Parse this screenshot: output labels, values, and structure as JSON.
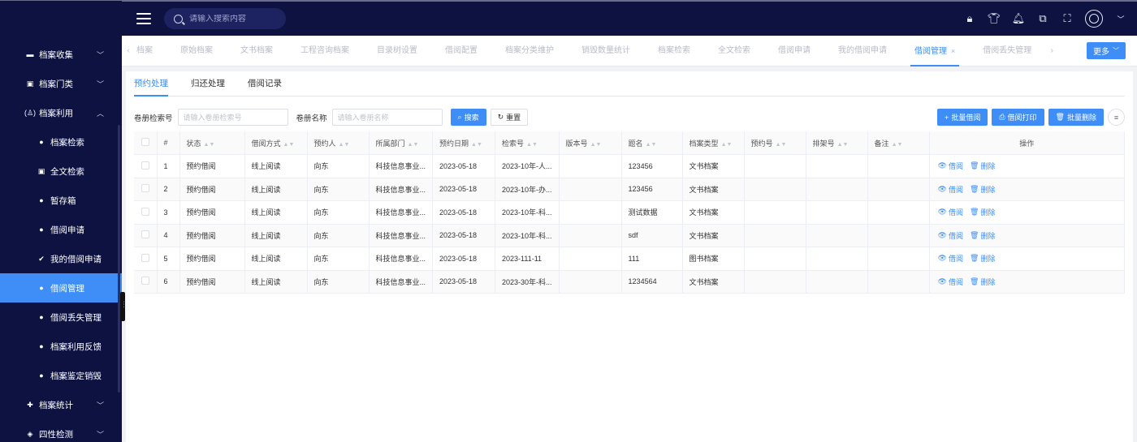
{
  "search": {
    "placeholder": "请输入搜索内容"
  },
  "sidebar": {
    "items": [
      {
        "label": "档案收集",
        "icon": "folder-icon",
        "chev": "﹀"
      },
      {
        "label": "档案门类",
        "icon": "calendar-icon",
        "chev": "﹀"
      },
      {
        "label": "档案利用",
        "icon": "person-icon",
        "chev": "︿"
      },
      {
        "label": "档案检索",
        "icon": "dot-icon"
      },
      {
        "label": "全文检索",
        "icon": "doc-icon"
      },
      {
        "label": "暂存箱",
        "icon": "dot-icon"
      },
      {
        "label": "借阅申请",
        "icon": "dot-icon"
      },
      {
        "label": "我的借阅申请",
        "icon": "check-icon"
      },
      {
        "label": "借阅管理",
        "icon": "dot-icon"
      },
      {
        "label": "借阅丢失管理",
        "icon": "dot-icon"
      },
      {
        "label": "档案利用反馈",
        "icon": "dot-icon"
      },
      {
        "label": "档案鉴定销毁",
        "icon": "dot-icon"
      },
      {
        "label": "档案统计",
        "icon": "plus-icon",
        "chev": "﹀"
      },
      {
        "label": "四性检测",
        "icon": "shield-icon",
        "chev": "﹀"
      }
    ]
  },
  "tabs": {
    "items": [
      "档案",
      "原始档案",
      "文书档案",
      "工程咨询档案",
      "目录树设置",
      "借阅配置",
      "档案分类维护",
      "销毁数量统计",
      "档案检索",
      "全文检索",
      "借阅申请",
      "我的借阅申请",
      "借阅管理",
      "借阅丢失管理"
    ],
    "close": "×",
    "more": "更多"
  },
  "subtabs": [
    "预约处理",
    "归还处理",
    "借阅记录"
  ],
  "filters": {
    "label1": "卷册检索号",
    "placeholder1": "请输入卷册检索号",
    "label2": "卷册名称",
    "placeholder2": "请输入卷册名称",
    "search_btn": "搜索",
    "reset_btn": "重置"
  },
  "actions": {
    "batch_borrow": "批量借阅",
    "borrow_print": "借阅打印",
    "batch_delete": "批量删除"
  },
  "table": {
    "headers": [
      "#",
      "状态",
      "借阅方式",
      "预约人",
      "所属部门",
      "预约日期",
      "检索号",
      "版本号",
      "题名",
      "档案类型",
      "预约号",
      "排架号",
      "备注",
      "操作"
    ],
    "op_borrow": "借阅",
    "op_delete": "删除",
    "rows": [
      [
        "1",
        "预约借阅",
        "线上阅读",
        "向东",
        "科技信息事业...",
        "2023-05-18",
        "2023-10年-人...",
        "",
        "123456",
        "文书档案",
        "",
        "",
        ""
      ],
      [
        "2",
        "预约借阅",
        "线上阅读",
        "向东",
        "科技信息事业...",
        "2023-05-18",
        "2023-10年-办...",
        "",
        "123456",
        "文书档案",
        "",
        "",
        ""
      ],
      [
        "3",
        "预约借阅",
        "线上阅读",
        "向东",
        "科技信息事业...",
        "2023-05-18",
        "2023-10年-科...",
        "",
        "测试数据",
        "文书档案",
        "",
        "",
        ""
      ],
      [
        "4",
        "预约借阅",
        "线上阅读",
        "向东",
        "科技信息事业...",
        "2023-05-18",
        "2023-10年-科...",
        "",
        "sdf",
        "文书档案",
        "",
        "",
        ""
      ],
      [
        "5",
        "预约借阅",
        "线上阅读",
        "向东",
        "科技信息事业...",
        "2023-05-18",
        "2023-111-11",
        "",
        "111",
        "图书档案",
        "",
        "",
        ""
      ],
      [
        "6",
        "预约借阅",
        "线上阅读",
        "向东",
        "科技信息事业...",
        "2023-05-18",
        "2023-30年-科...",
        "",
        "1234564",
        "文书档案",
        "",
        "",
        ""
      ]
    ]
  },
  "colors": {
    "accent": "#3f8ef7",
    "nav_bg": "#0d1240"
  }
}
